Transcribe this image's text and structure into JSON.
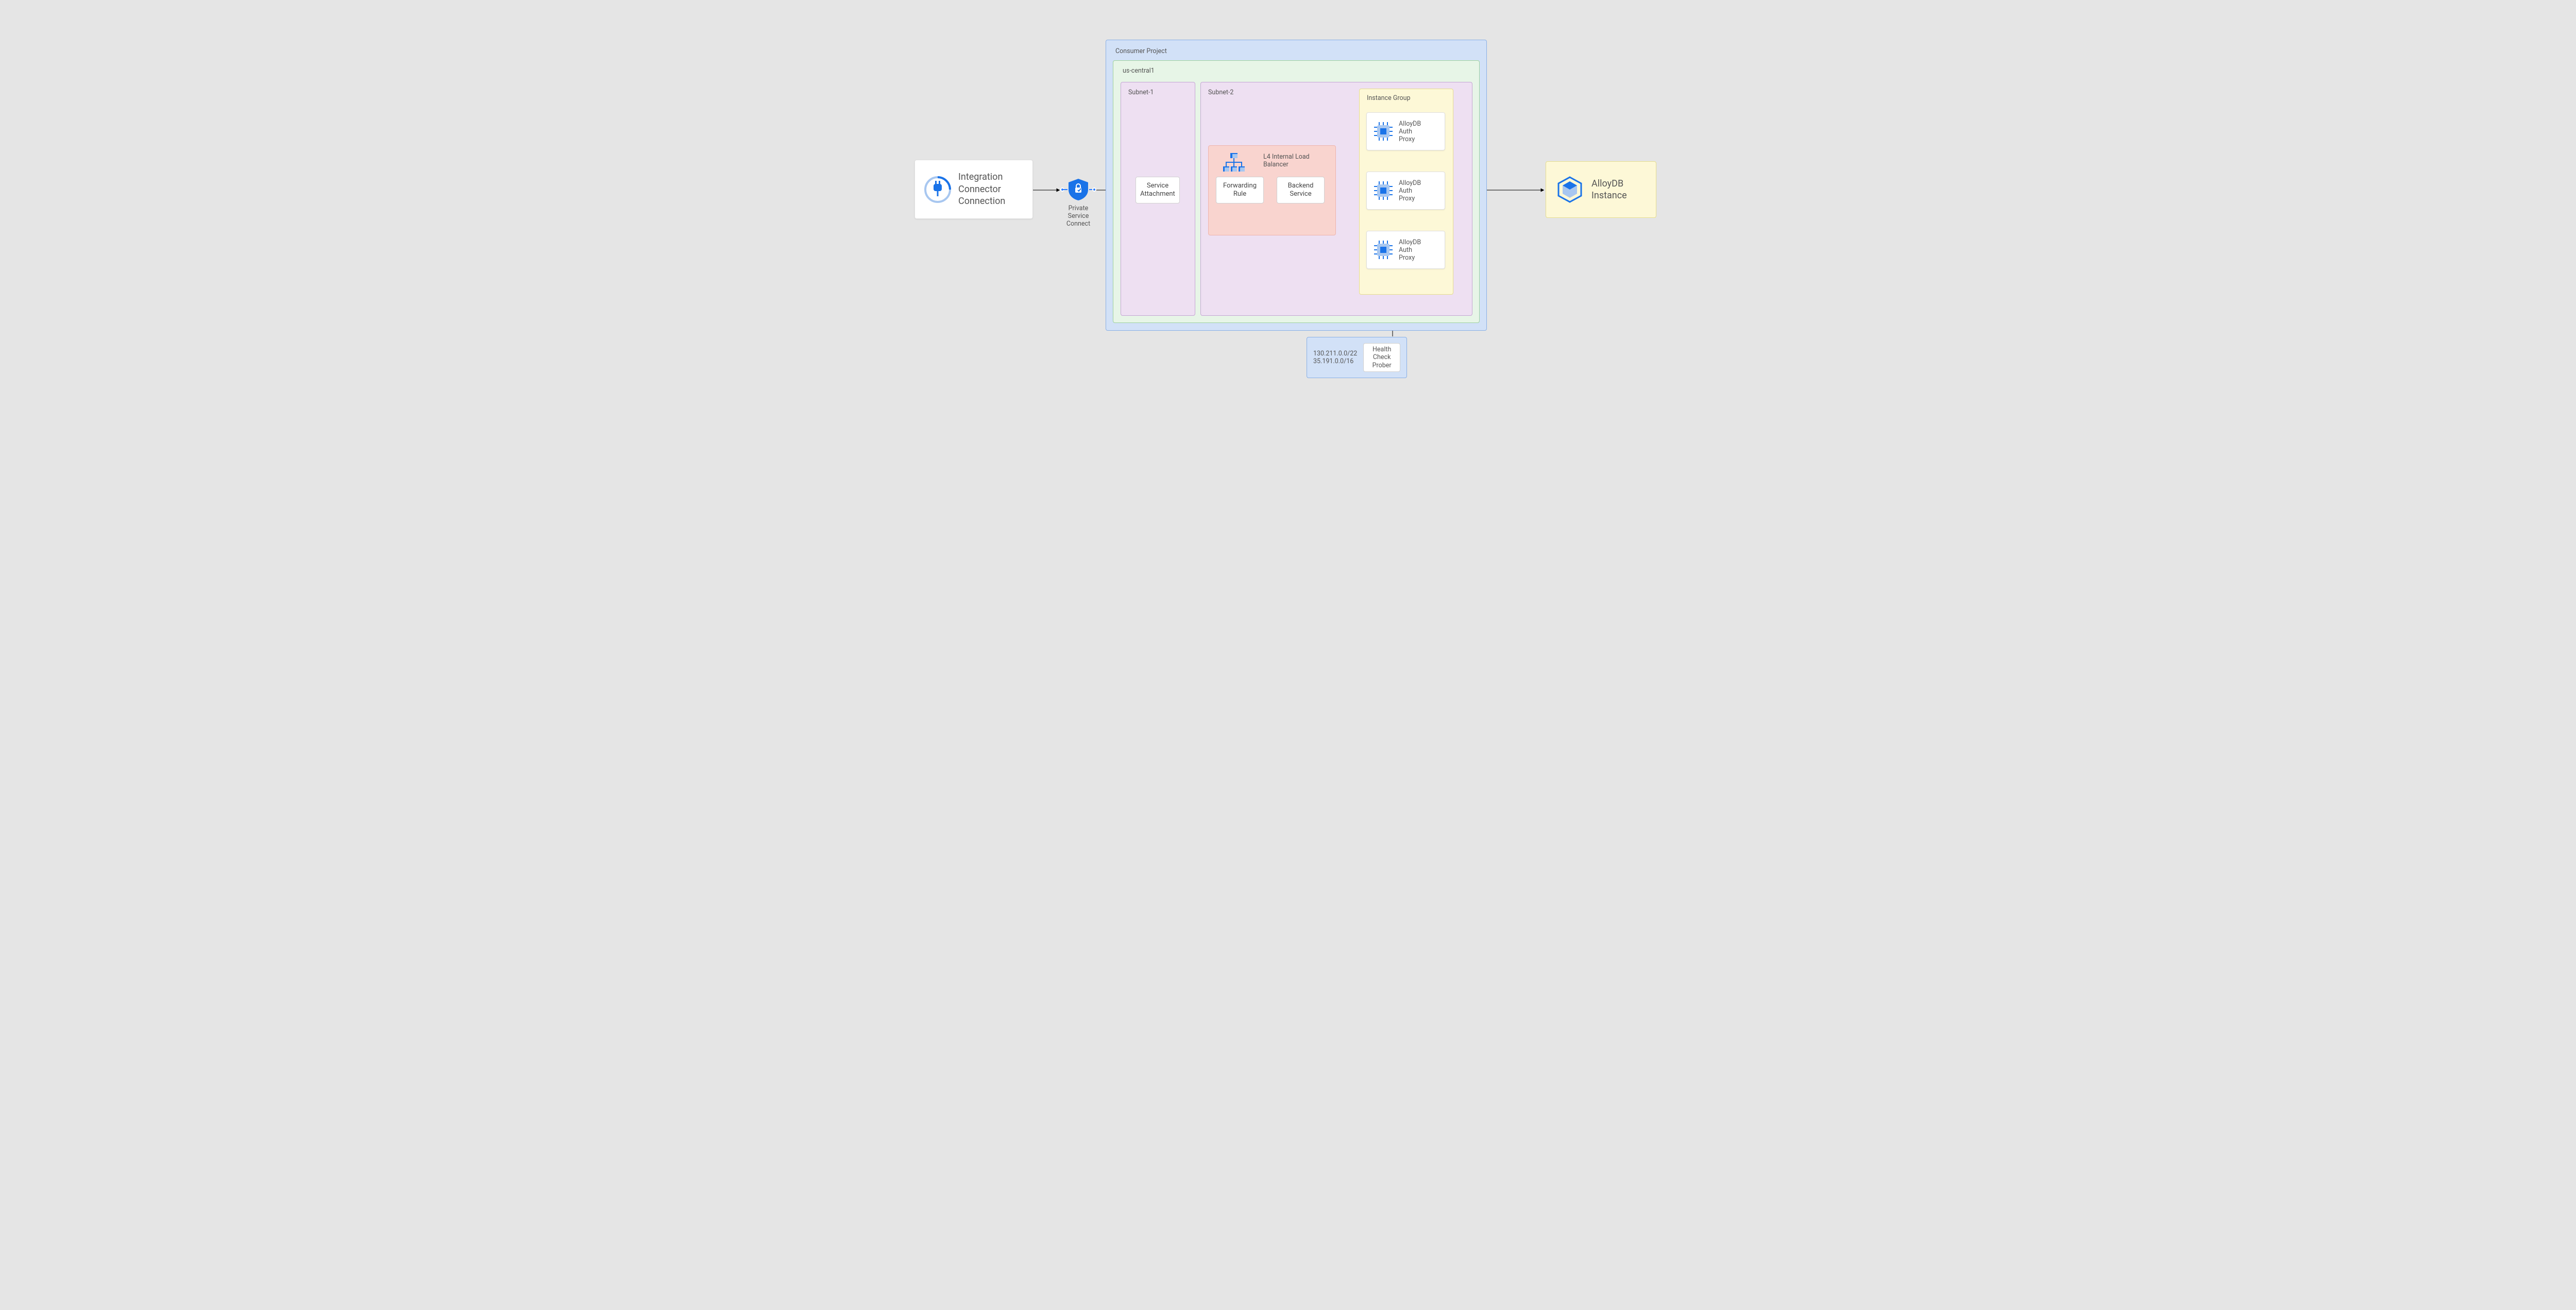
{
  "left_node": {
    "title": "Integration\nConnector\nConnection"
  },
  "psc": {
    "label": "Private\nService\nConnect"
  },
  "consumer_project": {
    "label": "Consumer Project"
  },
  "region": {
    "label": "us-central1"
  },
  "subnet1": {
    "label": "Subnet-1",
    "service_attachment": "Service\nAttachment"
  },
  "subnet2": {
    "label": "Subnet-2",
    "lb": {
      "label": "L4 Internal Load\nBalancer",
      "forwarding_rule": "Forwarding\nRule",
      "backend_service": "Backend\nService"
    }
  },
  "instance_group": {
    "label": "Instance Group",
    "item_label": "AlloyDB\nAuth\nProxy"
  },
  "right_node": {
    "title": "AlloyDB\nInstance"
  },
  "health_check": {
    "ips": "130.211.0.0/22\n35.191.0.0/16",
    "label": "Health Check\nProber"
  }
}
